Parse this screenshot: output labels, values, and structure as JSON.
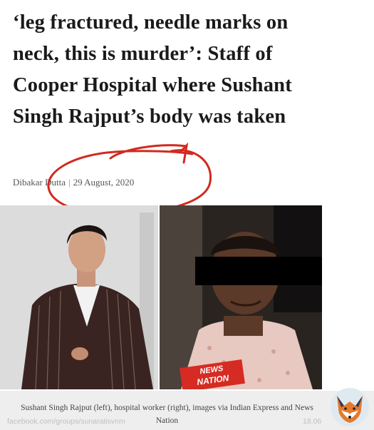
{
  "article": {
    "headline": "‘leg fractured, needle marks on neck, this is murder’: Staff of Cooper Hospital where Sushant Singh Rajput’s body was taken",
    "author": "Dibakar Dutta",
    "separator": "|",
    "date": "29 August, 2020"
  },
  "image": {
    "badge_line1": "NEWS",
    "badge_line2": "NATION",
    "caption": "Sushant Singh Rajput (left), hospital worker (right), images via Indian Express and News Nation"
  },
  "watermark": {
    "url": "facebook.com/groups/sunaratisvnm",
    "date": "18.06"
  },
  "colors": {
    "annotation_red": "#d12a1f",
    "caption_bg": "#eeeeee",
    "badge_red": "#d52b23"
  }
}
